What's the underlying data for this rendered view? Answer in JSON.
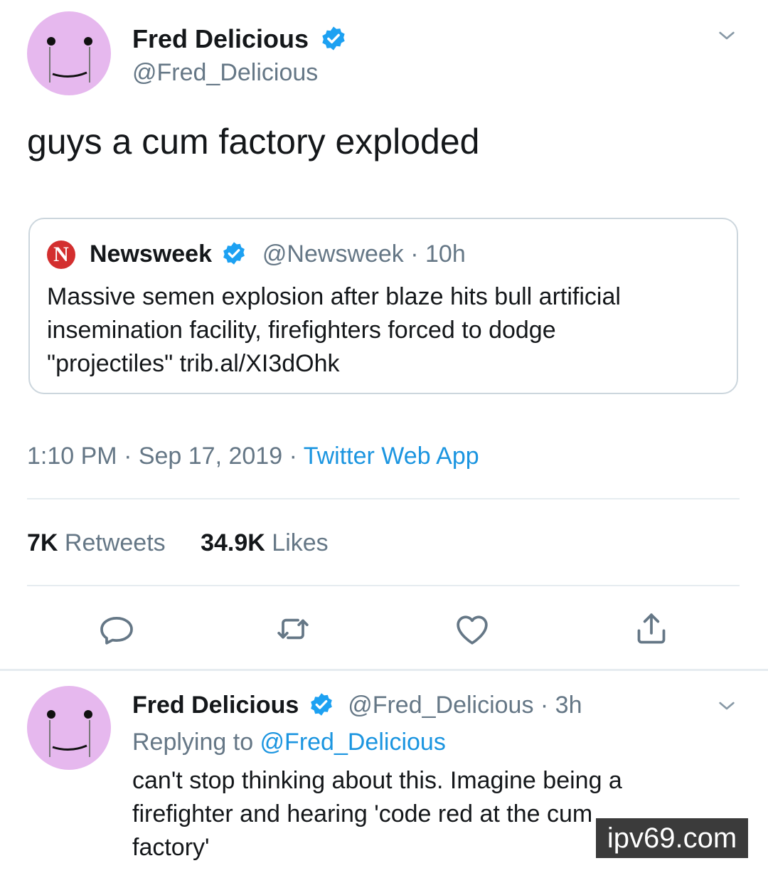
{
  "main_tweet": {
    "author_name": "Fred Delicious",
    "author_handle": "@Fred_Delicious",
    "text": "guys a cum factory exploded",
    "avatar_icon": "smiley-face-avatar",
    "verified_icon": "verified-badge-icon",
    "menu_icon": "chevron-down-icon"
  },
  "quoted_tweet": {
    "logo_letter": "N",
    "author_name": "Newsweek",
    "handle_time": "@Newsweek · 10h",
    "text_line1": "Massive semen explosion after blaze hits bull artificial",
    "text_line2": "insemination facility, firefighters forced to dodge",
    "text_line3": "\"projectiles\" trib.al/XI3dOhk"
  },
  "meta": {
    "time_date": "1:10 PM · Sep 17, 2019 · ",
    "source": "Twitter Web App"
  },
  "stats": {
    "retweets_count": "7K",
    "retweets_label": "Retweets",
    "likes_count": "34.9K",
    "likes_label": "Likes"
  },
  "actions": [
    "reply-icon",
    "retweet-icon",
    "like-icon",
    "share-icon"
  ],
  "reply_tweet": {
    "author_name": "Fred Delicious",
    "handle_time": "@Fred_Delicious · 3h",
    "replying_prefix": "Replying to ",
    "replying_to": "@Fred_Delicious",
    "text_line1": "can't stop thinking about this. Imagine being a",
    "text_line2": "firefighter and hearing 'code red at the cum",
    "text_line3": "factory'"
  },
  "watermark": "ipv69.com",
  "colors": {
    "accent": "#1b95e0",
    "avatar": "#e6b8ee",
    "secondary_text": "#657786",
    "newsweek_red": "#d32f2f"
  }
}
